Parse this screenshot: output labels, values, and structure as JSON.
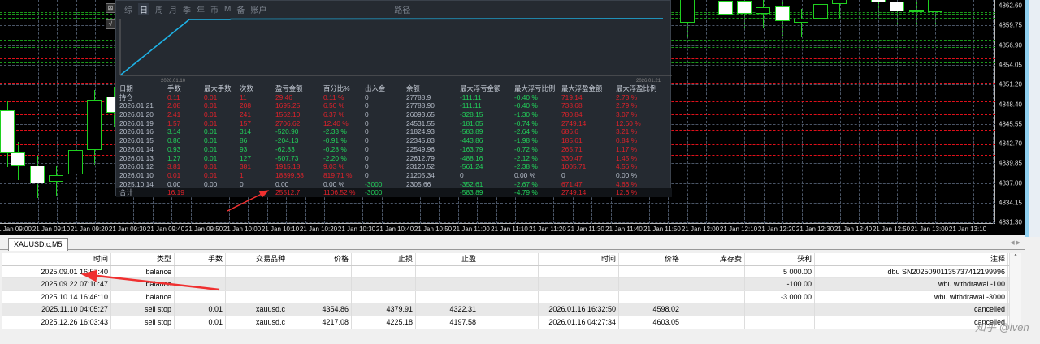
{
  "chart": {
    "symbol_tab": "XAUUSD.c,M5",
    "price_labels": [
      "4862.60",
      "4859.75",
      "4856.90",
      "4854.05",
      "4851.20",
      "4848.40",
      "4845.55",
      "4842.70",
      "4839.85",
      "4837.00",
      "4834.15",
      "4831.30"
    ],
    "time_labels": [
      "1 Jan 09:00",
      "21 Jan 09:10",
      "21 Jan 09:20",
      "21 Jan 09:30",
      "21 Jan 09:40",
      "21 Jan 09:50",
      "21 Jan 10:00",
      "21 Jan 10:10",
      "21 Jan 10:20",
      "21 Jan 10:30",
      "21 Jan 10:40",
      "21 Jan 10:50",
      "21 Jan 11:00",
      "21 Jan 11:10",
      "21 Jan 11:20",
      "21 Jan 11:30",
      "21 Jan 11:40",
      "21 Jan 11:50",
      "21 Jan 12:00",
      "21 Jan 12:10",
      "21 Jan 12:20",
      "21 Jan 12:30",
      "21 Jan 12:40",
      "21 Jan 12:50",
      "21 Jan 13:00",
      "21 Jan 13:10"
    ],
    "colors": {
      "bull": "#1fd01f",
      "sell_line": "#e0101a",
      "buy_line": "#1a9a1a"
    }
  },
  "popup": {
    "tabs": [
      "综",
      "日",
      "周",
      "月",
      "季",
      "年",
      "币",
      "M",
      "备",
      "账户",
      "路径"
    ],
    "active_tab": "日",
    "equity_start_label": "2026.01.10",
    "equity_end_label": "2026.01.21",
    "line_color": "#1eb4e8",
    "headers": [
      "日期",
      "手数",
      "最大手数",
      "次数",
      "盈亏金额",
      "百分比%",
      "出入金",
      "余额",
      "最大浮亏金额",
      "最大浮亏比例",
      "最大浮盈金额",
      "最大浮盈比例"
    ],
    "rows": [
      {
        "tone": "r",
        "cells": [
          "持仓",
          "0.11",
          "0.01",
          "11",
          "29.46",
          "0.11 %",
          "0",
          "27788.9",
          "-111.11",
          "-0.40 %",
          "719.14",
          "2.73 %"
        ]
      },
      {
        "tone": "r",
        "cells": [
          "2026.01.21",
          "2.08",
          "0.01",
          "208",
          "1695.25",
          "6.50 %",
          "0",
          "27788.90",
          "-111.11",
          "-0.40 %",
          "738.68",
          "2.79 %"
        ]
      },
      {
        "tone": "r",
        "cells": [
          "2026.01.20",
          "2.41",
          "0.01",
          "241",
          "1562.10",
          "6.37 %",
          "0",
          "26093.65",
          "-328.15",
          "-1.30 %",
          "780.84",
          "3.07 %"
        ]
      },
      {
        "tone": "r",
        "cells": [
          "2026.01.19",
          "1.57",
          "0.01",
          "157",
          "2706.62",
          "12.40 %",
          "0",
          "24531.55",
          "-181.05",
          "-0.74 %",
          "2749.14",
          "12.60 %"
        ]
      },
      {
        "tone": "g",
        "cells": [
          "2026.01.16",
          "3.14",
          "0.01",
          "314",
          "-520.90",
          "-2.33 %",
          "0",
          "21824.93",
          "-583.89",
          "-2.64 %",
          "686.6",
          "3.21 %"
        ]
      },
      {
        "tone": "g",
        "cells": [
          "2026.01.15",
          "0.86",
          "0.01",
          "86",
          "-204.13",
          "-0.91 %",
          "0",
          "22345.83",
          "-443.86",
          "-1.98 %",
          "185.61",
          "0.84 %"
        ]
      },
      {
        "tone": "g",
        "cells": [
          "2026.01.14",
          "0.93",
          "0.01",
          "93",
          "-62.83",
          "-0.28 %",
          "0",
          "22549.96",
          "-163.79",
          "-0.72 %",
          "265.71",
          "1.17 %"
        ]
      },
      {
        "tone": "g",
        "cells": [
          "2026.01.13",
          "1.27",
          "0.01",
          "127",
          "-507.73",
          "-2.20 %",
          "0",
          "22612.79",
          "-488.16",
          "-2.12 %",
          "330.47",
          "1.45 %"
        ]
      },
      {
        "tone": "r",
        "cells": [
          "2026.01.12",
          "3.81",
          "0.01",
          "381",
          "1915.18",
          "9.03 %",
          "0",
          "23120.52",
          "-561.24",
          "-2.38 %",
          "1005.71",
          "4.56 %"
        ]
      },
      {
        "tone": "r",
        "cells": [
          "2026.01.10",
          "0.01",
          "0.01",
          "1",
          "18899.68",
          "819.71 %",
          "0",
          "21205.34",
          "0",
          "0.00 %",
          "0",
          "0.00 %"
        ]
      },
      {
        "tone": "n",
        "cells": [
          "2025.10.14",
          "0.00",
          "0.00",
          "0",
          "0.00",
          "0.00 %",
          "-3000",
          "2305.66",
          "-352.61",
          "-2.67 %",
          "671.47",
          "4.66 %"
        ]
      }
    ],
    "total": {
      "label": "合计",
      "lots": "16.19",
      "profit": "25512.7",
      "percent": "1106.52 %",
      "flow": "-3000",
      "max_loss": "-583.89",
      "max_loss_pct": "-4.79 %",
      "max_gain": "2749.14",
      "max_gain_pct": "12.6 %"
    }
  },
  "history": {
    "headers": [
      "时间",
      "类型",
      "手数",
      "交易品种",
      "价格",
      "止损",
      "止盈",
      "",
      "时间",
      "价格",
      "库存费",
      "获利",
      "注释"
    ],
    "rows": [
      [
        "2025.09.01 16:57:40",
        "balance",
        "",
        "",
        "",
        "",
        "",
        "",
        "",
        "",
        "",
        "5 000.00",
        "dbu SN20250901135737412199996"
      ],
      [
        "2025.09.22 07:10:47",
        "balance",
        "",
        "",
        "",
        "",
        "",
        "",
        "",
        "",
        "",
        "-100.00",
        "wbu withdrawal -100"
      ],
      [
        "2025.10.14 16:46:10",
        "balance",
        "",
        "",
        "",
        "",
        "",
        "",
        "",
        "",
        "",
        "-3 000.00",
        "wbu withdrawal -3000"
      ],
      [
        "2025.11.10 04:05:27",
        "sell stop",
        "0.01",
        "xauusd.c",
        "4354.86",
        "4379.91",
        "4322.31",
        "",
        "2026.01.16 16:32:50",
        "4598.02",
        "",
        "",
        "cancelled"
      ],
      [
        "2025.12.26 16:03:43",
        "sell stop",
        "0.01",
        "xauusd.c",
        "4217.08",
        "4225.18",
        "4197.58",
        "",
        "2026.01.16 04:27:34",
        "4603.05",
        "",
        "",
        "cancelled"
      ]
    ]
  },
  "watermark": "知乎 @iven"
}
